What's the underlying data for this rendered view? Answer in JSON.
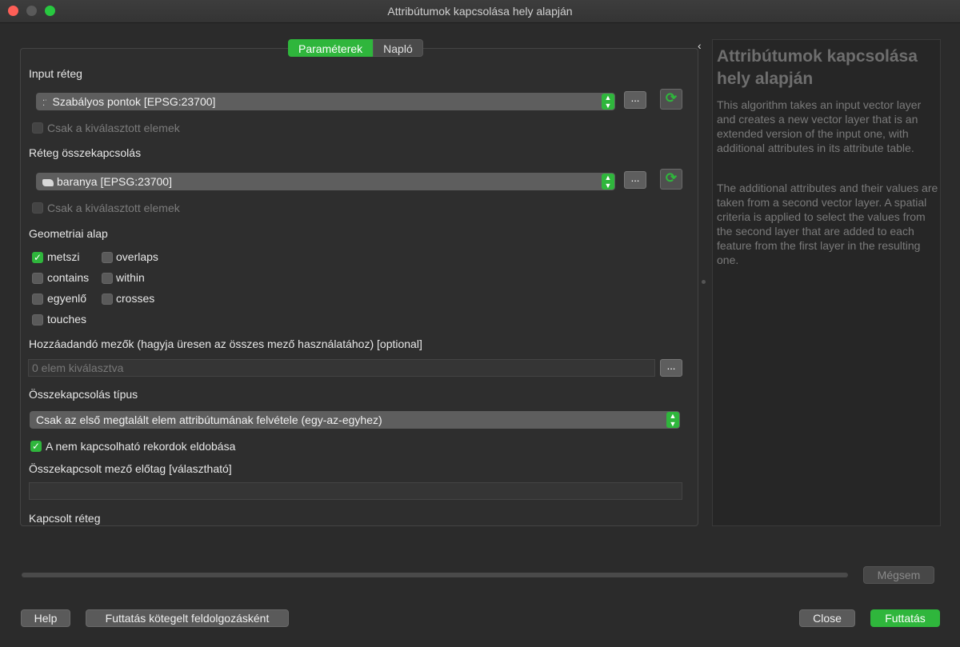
{
  "window": {
    "title": "Attribútumok kapcsolása hely alapján"
  },
  "tabs": {
    "params": "Paraméterek",
    "log": "Napló"
  },
  "form": {
    "input_layer_label": "Input réteg",
    "input_layer_value": "Szabályos pontok [EPSG:23700]",
    "selected_only_1": "Csak a kiválasztott elemek",
    "join_layer_label": "Réteg összekapcsolás",
    "join_layer_value": "baranya [EPSG:23700]",
    "selected_only_2": "Csak a kiválasztott elemek",
    "geom_label": "Geometriai alap",
    "predicates": {
      "intersects": "metszi",
      "overlaps": "overlaps",
      "contains": "contains",
      "within": "within",
      "equals": "egyenlő",
      "crosses": "crosses",
      "touches": "touches"
    },
    "fields_label": "Hozzáadandó mezők (hagyja üresen az összes mező használatához) [optional]",
    "fields_placeholder": "0 elem kiválasztva",
    "join_type_label": "Összekapcsolás típus",
    "join_type_value": "Csak az első megtalált elem attribútumának felvétele (egy-az-egyhez)",
    "discard_label": "A nem kapcsolható rekordok eldobása",
    "prefix_label": "Összekapcsolt mező előtag [választható]",
    "prefix_value": "",
    "joined_layer_label": "Kapcsolt réteg",
    "dots": "..."
  },
  "help": {
    "title": "Attribútumok kapcsolása hely alapján",
    "p1": "This algorithm takes an input vector layer and creates a new vector layer that is an extended version of the input one, with additional attributes in its attribute table.",
    "p2": "The additional attributes and their values are taken from a second vector layer. A spatial criteria is applied to select the values from the second layer that are added to each feature from the first layer in the resulting one."
  },
  "buttons": {
    "cancel": "Mégsem",
    "help": "Help",
    "batch": "Futtatás kötegelt feldolgozásként",
    "close": "Close",
    "run": "Futtatás"
  },
  "colors": {
    "accent": "#2fb63c",
    "bg": "#2b2b2b"
  }
}
